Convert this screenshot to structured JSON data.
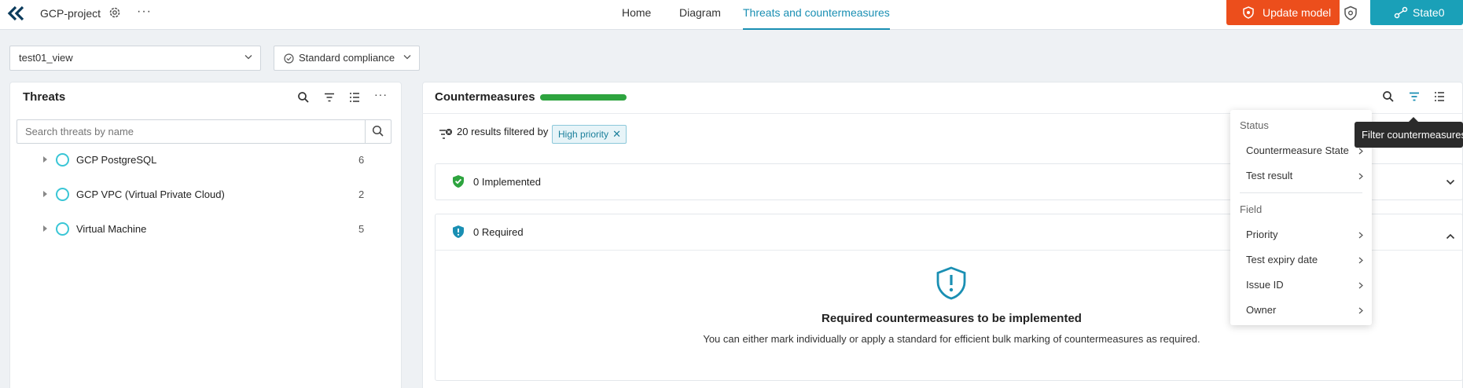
{
  "header": {
    "project_name": "GCP-project",
    "nav": [
      "Home",
      "Diagram",
      "Threats and countermeasures"
    ],
    "update_label": "Update model",
    "state_label": "State0",
    "accent_color": "#1a8fb3",
    "update_color": "#ec4e1c",
    "state_color": "#1aa0b8"
  },
  "toolbar": {
    "view_select": "test01_view",
    "compliance_select": "Standard compliance"
  },
  "threats": {
    "title": "Threats",
    "search_placeholder": "Search threats by name",
    "items": [
      {
        "name": "GCP PostgreSQL",
        "count": "6"
      },
      {
        "name": "GCP VPC (Virtual Private Cloud)",
        "count": "2"
      },
      {
        "name": "Virtual Machine",
        "count": "5"
      }
    ]
  },
  "countermeasures": {
    "title": "Countermeasures",
    "results_text": "20 results filtered by",
    "filter_chip": "High priority",
    "sections": [
      {
        "label": "0 Implemented"
      },
      {
        "label": "0 Required"
      }
    ],
    "empty_title": "Required countermeasures to be implemented",
    "empty_desc": "You can either mark individually or apply a standard for efficient bulk marking of countermeasures as required."
  },
  "filter_menu": {
    "group_status": "Status",
    "status_items": [
      "Countermeasure State",
      "Test result"
    ],
    "group_field": "Field",
    "field_items": [
      "Priority",
      "Test expiry date",
      "Issue ID",
      "Owner"
    ],
    "tooltip": "Filter countermeasures"
  }
}
